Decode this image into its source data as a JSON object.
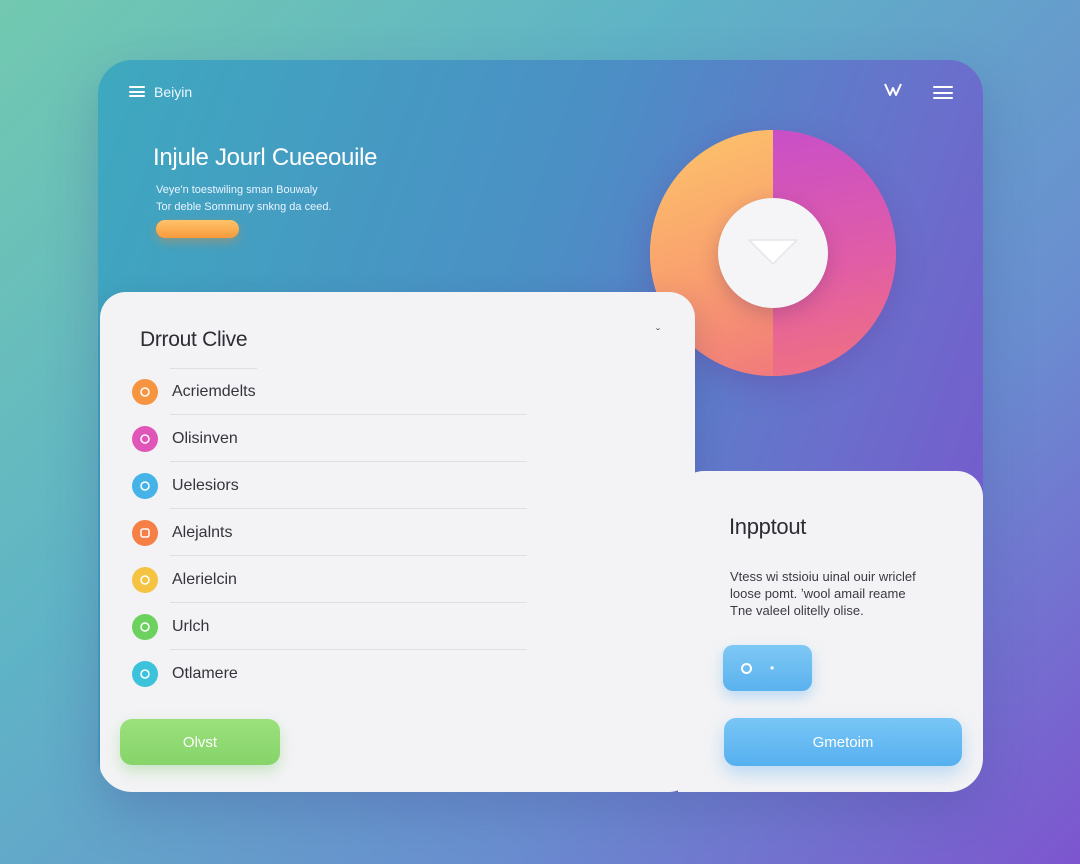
{
  "header": {
    "app_title": "Beiyin",
    "brand_icon": "v-logo-icon",
    "menu_icon": "hamburger-icon"
  },
  "hero": {
    "title": "Injule Jourl Cueeouile",
    "subtitle_lines": [
      "Veye'n toestwiling sman Bouwaly",
      "Tor deble Sommuny snkng da ceed."
    ]
  },
  "list_card": {
    "title": "Drrout Clive",
    "close_glyph": "ˇ",
    "items": [
      {
        "label": "Acriemdelts",
        "icon": "circle-icon",
        "color": "#f7943f"
      },
      {
        "label": "Olisinven",
        "icon": "circle-icon",
        "color": "#e056b8"
      },
      {
        "label": "Uelesiors",
        "icon": "circle-icon",
        "color": "#45b3e8"
      },
      {
        "label": "Alejalnts",
        "icon": "square-icon",
        "color": "#f57f45"
      },
      {
        "label": "Alerielcin",
        "icon": "circle-icon",
        "color": "#f4c341"
      },
      {
        "label": "Urlch",
        "icon": "circle-icon",
        "color": "#6cd15e"
      },
      {
        "label": "Otlamere",
        "icon": "circle-icon",
        "color": "#3cc2db"
      }
    ],
    "primary_button": "Olvst"
  },
  "info_card": {
    "title": "Inpptout",
    "body_lines": [
      "Vtess wi stsioiu uinal ouir wriclef",
      "loose pomt. ʼwool amail reame",
      "Tne valeel olitelly olise."
    ],
    "small_button_label": "•",
    "primary_button": "Gmetoim"
  },
  "colors": {
    "accent_green": "#8ed972",
    "accent_blue": "#63b8f2",
    "accent_orange": "#f9a84a"
  }
}
